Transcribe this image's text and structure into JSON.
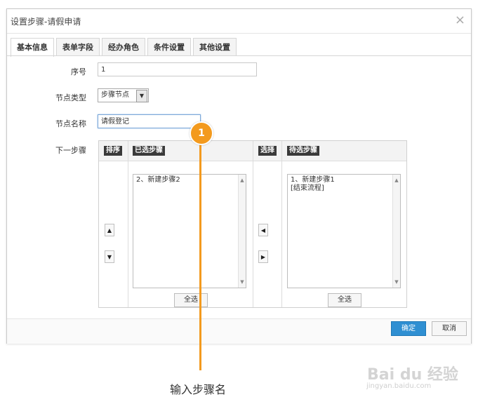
{
  "dialog": {
    "title": "设置步骤-请假申请",
    "close_glyph": "×"
  },
  "tabs": [
    {
      "label": "基本信息",
      "active": true
    },
    {
      "label": "表单字段",
      "active": false
    },
    {
      "label": "经办角色",
      "active": false
    },
    {
      "label": "条件设置",
      "active": false
    },
    {
      "label": "其他设置",
      "active": false
    }
  ],
  "form": {
    "seq_label": "序号",
    "seq_value": "1",
    "type_label": "节点类型",
    "type_value": "步骤节点",
    "name_label": "节点名称",
    "name_value": "请假登记",
    "next_label": "下一步骤"
  },
  "steps": {
    "sort_badge": "排序",
    "selected_badge": "已选步骤",
    "choose_badge": "选择",
    "pending_badge": "待选步骤",
    "selected_items": [
      "2、新建步骤2"
    ],
    "pending_items": [
      "1、新建步骤1",
      "[结束流程]"
    ],
    "select_all_label": "全选",
    "up_glyph": "▲",
    "down_glyph": "▼",
    "left_glyph": "◀",
    "right_glyph": "▶"
  },
  "footer": {
    "ok_label": "确定",
    "cancel_label": "取消"
  },
  "callout": {
    "number": "1",
    "caption": "输入步骤名"
  },
  "watermark": {
    "brand": "Bai du 经验",
    "url": "jingyan.baidu.com"
  },
  "colors": {
    "primary": "#2f8fd2",
    "callout": "#f39a1e"
  }
}
